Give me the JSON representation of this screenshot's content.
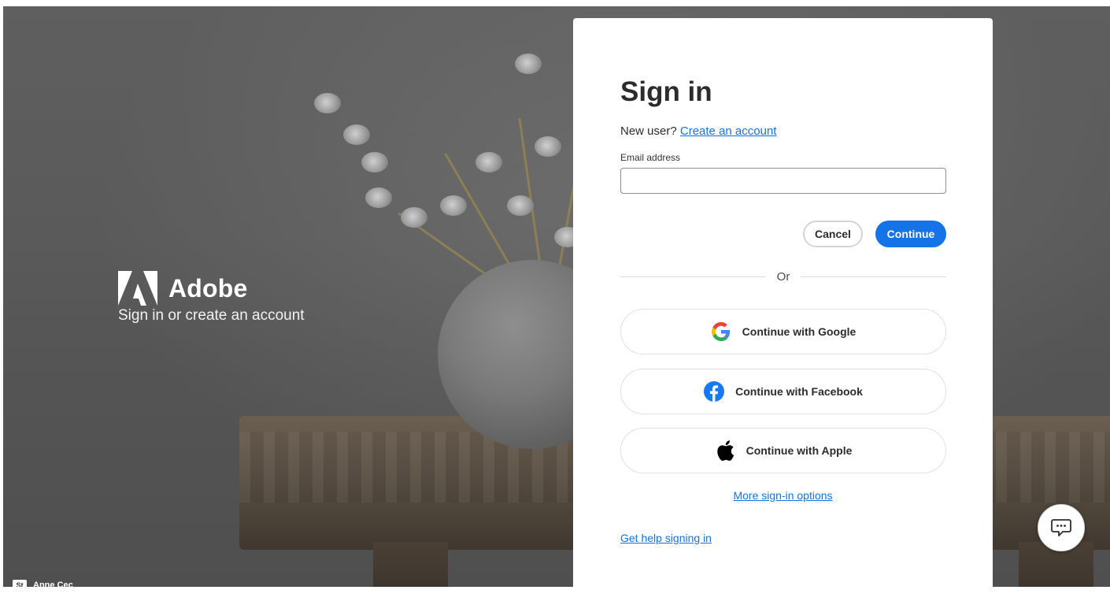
{
  "brand": {
    "name": "Adobe",
    "tagline": "Sign in or create an account",
    "logo_icon": "adobe-logo-icon"
  },
  "bottom_badge": {
    "icon_text": "St",
    "label": "Anne Cec"
  },
  "signin": {
    "title": "Sign in",
    "new_user_prefix": "New user?",
    "create_account_link": "Create an account",
    "email_label": "Email address",
    "email_value": "",
    "cancel_label": "Cancel",
    "continue_label": "Continue",
    "divider_text": "Or",
    "social": [
      {
        "label": "Continue with Google",
        "icon": "google-icon"
      },
      {
        "label": "Continue with Facebook",
        "icon": "facebook-icon"
      },
      {
        "label": "Continue with Apple",
        "icon": "apple-icon"
      }
    ],
    "more_options_link": "More sign-in options",
    "help_link": "Get help signing in"
  },
  "chat": {
    "icon": "chat-icon"
  },
  "colors": {
    "accent": "#1473e6",
    "facebook": "#1877f2",
    "card_background": "#ffffff"
  }
}
